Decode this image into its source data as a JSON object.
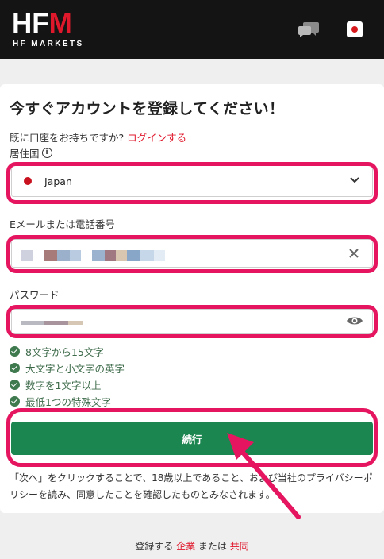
{
  "header": {
    "logo_text": "HFM",
    "logo_subtitle": "HF MARKETS",
    "icons": {
      "chat": "chat-bubbles-icon",
      "language": "japan-flag-icon"
    }
  },
  "form": {
    "title": "今すぐアカウントを登録してください！",
    "have_account_text": "既に口座をお持ちですか?",
    "login_link": "ログインする",
    "residence_label": "居住国",
    "country_value": "Japan",
    "email_label": "Eメールまたは電話番号",
    "password_label": "パスワード",
    "requirements": [
      "8文字から15文字",
      "大文字と小文字の英字",
      "数字を1文字以上",
      "最低1つの特殊文字"
    ],
    "continue_label": "続行",
    "notice": "「次へ」をクリックすることで、18歳以上であること、および当社のプライバシーポリシーを読み、同意したことを確認したものとみなされます。"
  },
  "footer": {
    "prefix": "登録する",
    "corporate_link": "企業",
    "middle": "または",
    "joint_link": "共同"
  },
  "colors": {
    "brand_red": "#e0182c",
    "header_bg": "#141414",
    "button_green": "#1c8650",
    "highlight_pink": "#e5155f",
    "check_green": "#3f7a4f"
  }
}
